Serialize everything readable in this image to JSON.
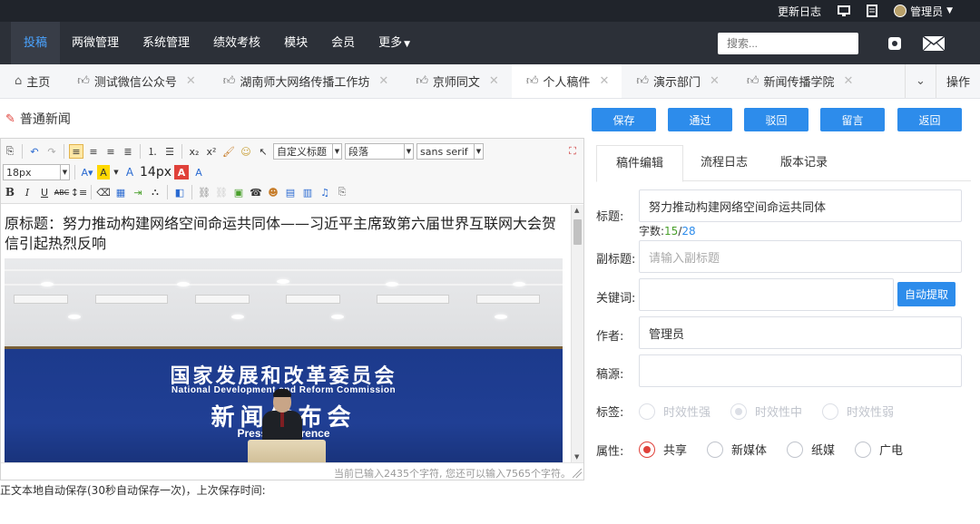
{
  "topbar": {
    "changelog": "更新日志",
    "user": "管理员"
  },
  "nav": {
    "items": [
      "投稿",
      "两微管理",
      "系统管理",
      "绩效考核",
      "模块",
      "会员",
      "更多"
    ],
    "search_placeholder": "搜索..."
  },
  "tabs": {
    "items": [
      "主页",
      "测试微信公众号",
      "湖南师大网络传播工作坊",
      "京师同文",
      "个人稿件",
      "演示部门",
      "新闻传播学院"
    ],
    "ops": "操作"
  },
  "page": {
    "title": "普通新闻"
  },
  "actions": {
    "save": "保存",
    "pass": "通过",
    "reject": "驳回",
    "comment": "留言",
    "back": "返回"
  },
  "editor": {
    "font_size": "18px",
    "font_size_display": "14px",
    "custom_heading": "自定义标题",
    "paragraph": "段落",
    "font_family": "sans serif",
    "original_title": "原标题：努力推动构建网络空间命运共同体——习近平主席致第六届世界互联网大会贺信引起热烈反响",
    "photo": {
      "zh_line1": "国家发展和改革委员会",
      "en_line1": "National Development and Reform Commission",
      "zh_line2": "新闻发布会",
      "en_line2": "Press Conference"
    },
    "char_count": "当前已输入2435个字符, 您还可以输入7565个字符。",
    "autosave": "正文本地自动保存(30秒自动保存一次)，上次保存时间:"
  },
  "form": {
    "tabs": [
      "稿件编辑",
      "流程日志",
      "版本记录"
    ],
    "title_label": "标题:",
    "title_value": "努力推动构建网络空间命运共同体",
    "wordcount_label": "字数:",
    "wordcount_current": "15",
    "wordcount_sep": "/",
    "wordcount_max": "28",
    "subtitle_label": "副标题:",
    "subtitle_placeholder": "请输入副标题",
    "keywords_label": "关键词:",
    "auto_extract": "自动提取",
    "author_label": "作者:",
    "author_value": "管理员",
    "source_label": "稿源:",
    "tag_label": "标签:",
    "tags": [
      "时效性强",
      "时效性中",
      "时效性弱"
    ],
    "attr_label": "属性:",
    "attrs": [
      "共享",
      "新媒体",
      "纸媒",
      "广电"
    ]
  },
  "colors": {
    "accent": "#2d8ceb",
    "nav_bg": "#2c3038",
    "topbar_bg": "#20242b",
    "radio_checked": "#e0413a"
  }
}
